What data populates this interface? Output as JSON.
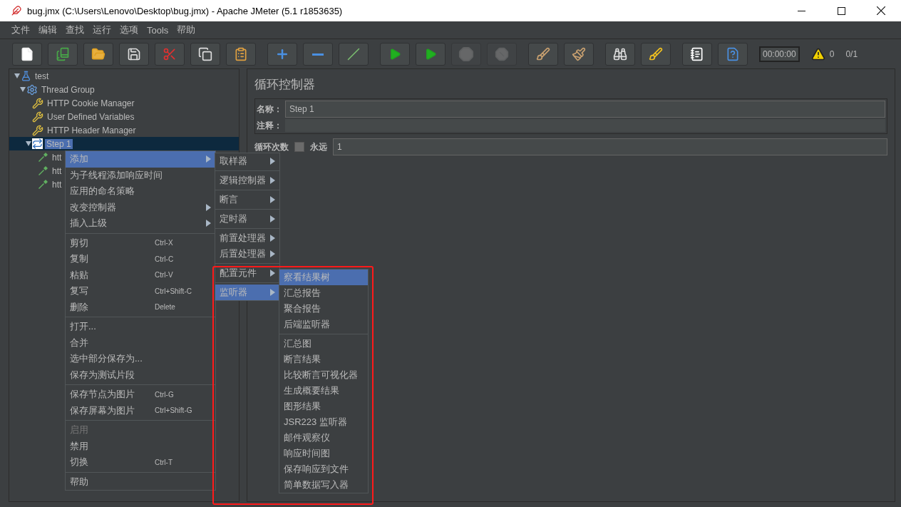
{
  "window": {
    "title": "bug.jmx (C:\\Users\\Lenovo\\Desktop\\bug.jmx) - Apache JMeter (5.1 r1853635)"
  },
  "menu_bar": [
    "文件",
    "编辑",
    "查找",
    "运行",
    "选项",
    "Tools",
    "帮助"
  ],
  "toolbar": {
    "groups": [
      [
        {
          "kind": "new",
          "disabled": false
        },
        {
          "kind": "templates",
          "disabled": false
        },
        {
          "kind": "open",
          "disabled": false
        },
        {
          "kind": "save",
          "disabled": false
        },
        {
          "kind": "cut",
          "disabled": false
        },
        {
          "kind": "copy",
          "disabled": false
        },
        {
          "kind": "paste",
          "disabled": false
        }
      ],
      [
        {
          "kind": "expand",
          "disabled": false
        },
        {
          "kind": "collapse",
          "disabled": false
        },
        {
          "kind": "toggle",
          "disabled": false
        }
      ],
      [
        {
          "kind": "start",
          "disabled": false
        },
        {
          "kind": "start_no_pause",
          "disabled": false
        },
        {
          "kind": "stop",
          "disabled": true
        },
        {
          "kind": "shutdown",
          "disabled": true
        }
      ],
      [
        {
          "kind": "clear",
          "disabled": false
        },
        {
          "kind": "clear_all",
          "disabled": false
        }
      ],
      [
        {
          "kind": "search",
          "disabled": false
        },
        {
          "kind": "reset_search",
          "disabled": false
        }
      ],
      [
        {
          "kind": "function_helper",
          "disabled": false
        },
        {
          "kind": "help",
          "disabled": false
        }
      ]
    ],
    "timer": "00:00:00",
    "warnings": "0",
    "threads": "0/1"
  },
  "tree": [
    {
      "label": "test",
      "kind": "plan",
      "expanded": true,
      "selected": false,
      "children": [
        {
          "label": "Thread Group",
          "kind": "thread_group",
          "expanded": true,
          "selected": false,
          "children": [
            {
              "label": "HTTP Cookie Manager",
              "kind": "config",
              "selected": false
            },
            {
              "label": "User Defined Variables",
              "kind": "config",
              "selected": false
            },
            {
              "label": "HTTP Header Manager",
              "kind": "config",
              "selected": false
            },
            {
              "label": "Step 1",
              "kind": "controller",
              "expanded": true,
              "selected": true,
              "children": [
                {
                  "label": "htt",
                  "kind": "sampler",
                  "selected": false
                },
                {
                  "label": "htt",
                  "kind": "sampler",
                  "selected": false
                },
                {
                  "label": "htt",
                  "kind": "sampler",
                  "selected": false
                }
              ]
            }
          ]
        }
      ]
    }
  ],
  "editor": {
    "title": "循环控制器",
    "name_label": "名称：",
    "name_value": "Step 1",
    "comment_label": "注释：",
    "loop_label": "循环次数",
    "forever_label": "永远",
    "forever_checked": false,
    "loop_value": "1"
  },
  "context_menu": {
    "groups": [
      [
        {
          "label": "添加",
          "submenu": true,
          "selected": true,
          "disabled": false
        },
        {
          "label": "为子线程添加响应时间",
          "submenu": false,
          "selected": false,
          "disabled": false
        },
        {
          "label": "应用的命名策略",
          "submenu": false,
          "selected": false,
          "disabled": false
        },
        {
          "label": "改变控制器",
          "submenu": true,
          "selected": false,
          "disabled": false
        },
        {
          "label": "插入上级",
          "submenu": true,
          "selected": false,
          "disabled": false
        }
      ],
      [
        {
          "label": "剪切",
          "shortcut": "Ctrl-X",
          "selected": false,
          "disabled": false
        },
        {
          "label": "复制",
          "shortcut": "Ctrl-C",
          "selected": false,
          "disabled": false
        },
        {
          "label": "粘贴",
          "shortcut": "Ctrl-V",
          "selected": false,
          "disabled": false
        },
        {
          "label": "复写",
          "shortcut": "Ctrl+Shift-C",
          "selected": false,
          "disabled": false
        },
        {
          "label": "删除",
          "shortcut": "Delete",
          "selected": false,
          "disabled": false
        }
      ],
      [
        {
          "label": "打开...",
          "selected": false,
          "disabled": false
        },
        {
          "label": "合并",
          "selected": false,
          "disabled": false
        },
        {
          "label": "选中部分保存为...",
          "selected": false,
          "disabled": false
        },
        {
          "label": "保存为测试片段",
          "selected": false,
          "disabled": false
        }
      ],
      [
        {
          "label": "保存节点为图片",
          "shortcut": "Ctrl-G",
          "selected": false,
          "disabled": false
        },
        {
          "label": "保存屏幕为图片",
          "shortcut": "Ctrl+Shift-G",
          "selected": false,
          "disabled": false
        }
      ],
      [
        {
          "label": "启用",
          "selected": false,
          "disabled": true
        },
        {
          "label": "禁用",
          "selected": false,
          "disabled": false
        },
        {
          "label": "切换",
          "shortcut": "Ctrl-T",
          "selected": false,
          "disabled": false
        }
      ],
      [
        {
          "label": "帮助",
          "selected": false,
          "disabled": false
        }
      ]
    ]
  },
  "add_submenu": {
    "groups": [
      [
        {
          "label": "取样器",
          "selected": false
        }
      ],
      [
        {
          "label": "逻辑控制器",
          "selected": false
        }
      ],
      [
        {
          "label": "断言",
          "selected": false
        }
      ],
      [
        {
          "label": "定时器",
          "selected": false
        }
      ],
      [
        {
          "label": "前置处理器",
          "selected": false
        },
        {
          "label": "后置处理器",
          "selected": false
        }
      ],
      [
        {
          "label": "配置元件",
          "selected": false
        }
      ],
      [
        {
          "label": "监听器",
          "selected": true
        }
      ]
    ]
  },
  "listener_submenu": {
    "groups": [
      [
        {
          "label": "察看结果树",
          "selected": true
        },
        {
          "label": "汇总报告",
          "selected": false
        },
        {
          "label": "聚合报告",
          "selected": false
        },
        {
          "label": "后端监听器",
          "selected": false
        }
      ],
      [
        {
          "label": "汇总图",
          "selected": false
        },
        {
          "label": "断言结果",
          "selected": false
        },
        {
          "label": "比较断言可视化器",
          "selected": false
        },
        {
          "label": "生成概要结果",
          "selected": false
        },
        {
          "label": "图形结果",
          "selected": false
        },
        {
          "label": "JSR223 监听器",
          "selected": false
        },
        {
          "label": "邮件观察仪",
          "selected": false
        },
        {
          "label": "响应时间图",
          "selected": false
        },
        {
          "label": "保存响应到文件",
          "selected": false
        },
        {
          "label": "简单数据写入器",
          "selected": false
        }
      ]
    ]
  }
}
